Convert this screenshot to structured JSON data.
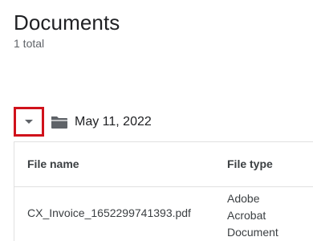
{
  "header": {
    "title": "Documents",
    "subtitle": "1 total"
  },
  "group": {
    "expand_icon": "caret-down-icon",
    "folder_icon": "folder-icon",
    "label": "May 11, 2022",
    "highlight_color": "#d0121b"
  },
  "table": {
    "columns": [
      "File name",
      "File type"
    ],
    "rows": [
      {
        "file_name": "CX_Invoice_1652299741393.pdf",
        "file_type": "Adobe Acrobat Document"
      }
    ]
  }
}
